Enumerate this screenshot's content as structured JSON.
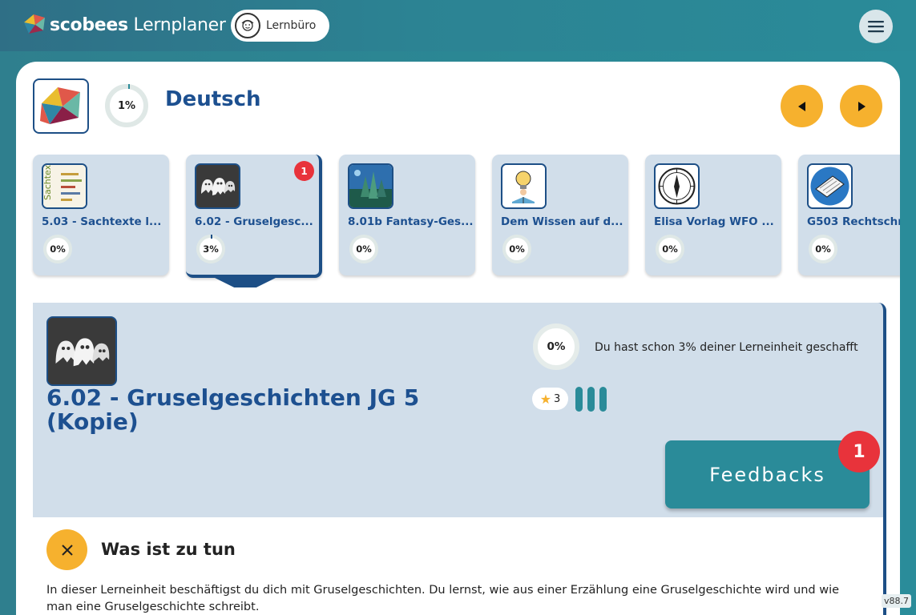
{
  "app": {
    "brand_bold": "scobees",
    "brand_light": "Lernplaner",
    "lernbuero_label": "Lernbüro",
    "version": "v88.7"
  },
  "subject": {
    "progress": "1%",
    "title": "Deutsch"
  },
  "units": [
    {
      "title": "5.03 - Sachtexte l...",
      "progress": "0%",
      "thumb": "sachtexte-wordcloud"
    },
    {
      "title": "6.02 - Gruselgesc...",
      "progress": "3%",
      "thumb": "ghosts",
      "badge": "1",
      "active": true
    },
    {
      "title": "8.01b Fantasy-Ges...",
      "progress": "0%",
      "thumb": "fantasy-castle"
    },
    {
      "title": "Dem Wissen auf d...",
      "progress": "0%",
      "thumb": "reader-lightbulb"
    },
    {
      "title": "Elisa Vorlag WFO ...",
      "progress": "0%",
      "thumb": "compass"
    },
    {
      "title": "G503 Rechtschr",
      "progress": "0%",
      "thumb": "keyboard"
    }
  ],
  "detail": {
    "title": "6.02 - Gruselgeschichten JG 5 (Kopie)",
    "progress": "0%",
    "progress_text": "Du hast schon 3% deiner Lerneinheit geschafft",
    "stars": "3",
    "feedback_label": "Feedbacks",
    "feedback_count": "1"
  },
  "task": {
    "title": "Was ist zu tun",
    "text": "In dieser Lerneinheit beschäftigst du dich mit Gruselgeschichten. Du lernst, wie aus einer Erzählung eine Gruselgeschichte wird und wie man eine Gruselgeschichte schreibt."
  },
  "colors": {
    "accent_orange": "#f6b12e",
    "brand_blue": "#1d4f86",
    "teal": "#2a8b99",
    "badge_red": "#e8333b",
    "card_bg": "#d1deea"
  }
}
